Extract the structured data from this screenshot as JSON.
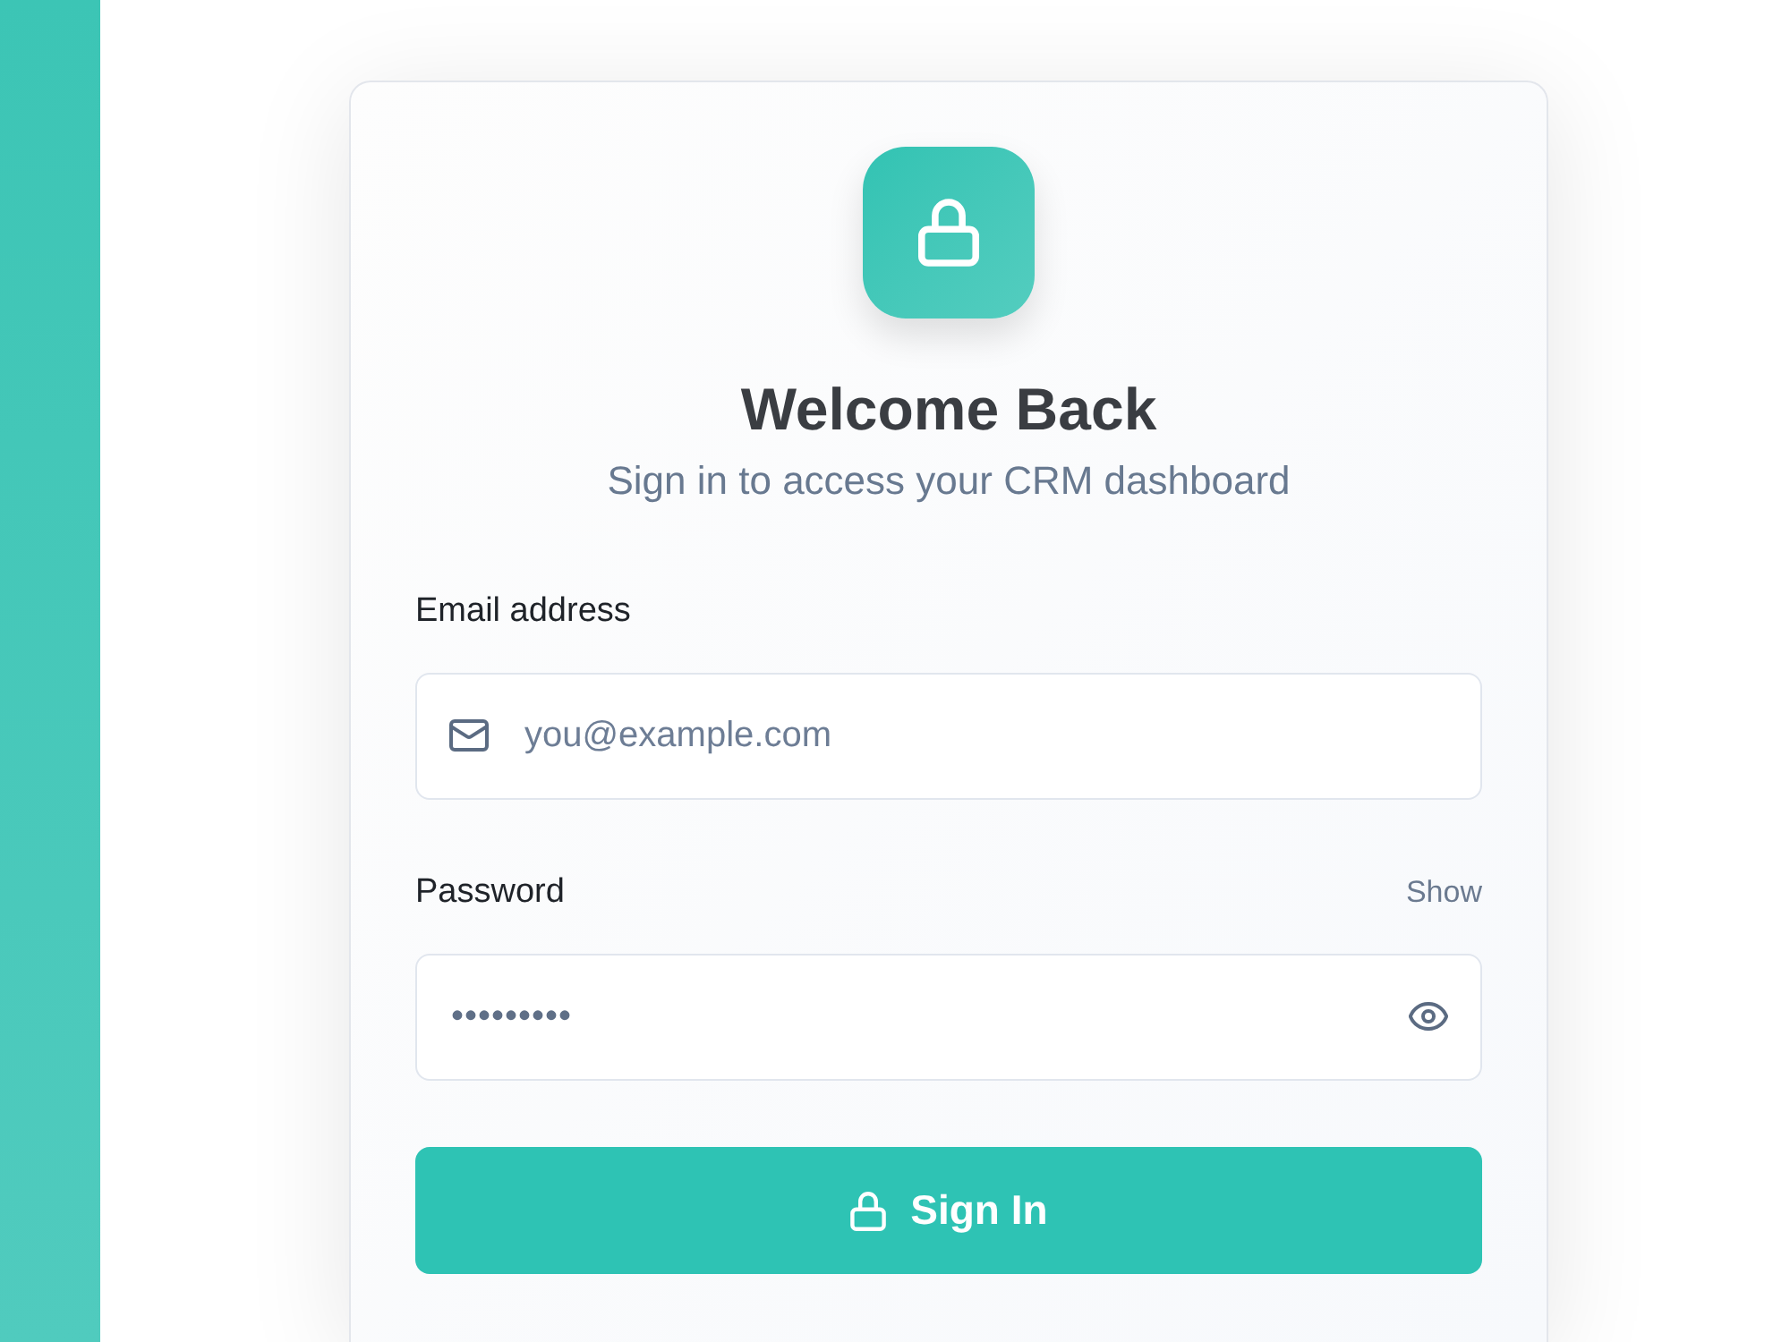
{
  "header": {
    "title": "Welcome Back",
    "subtitle": "Sign in to access your CRM dashboard"
  },
  "fields": [
    {
      "kind": "email",
      "label": "Email address",
      "placeholder": "you@example.com"
    },
    {
      "kind": "password",
      "label": "Password",
      "toggle": "Show",
      "placeholder": "•••••••••"
    }
  ],
  "submit": {
    "label": "Sign In"
  }
}
